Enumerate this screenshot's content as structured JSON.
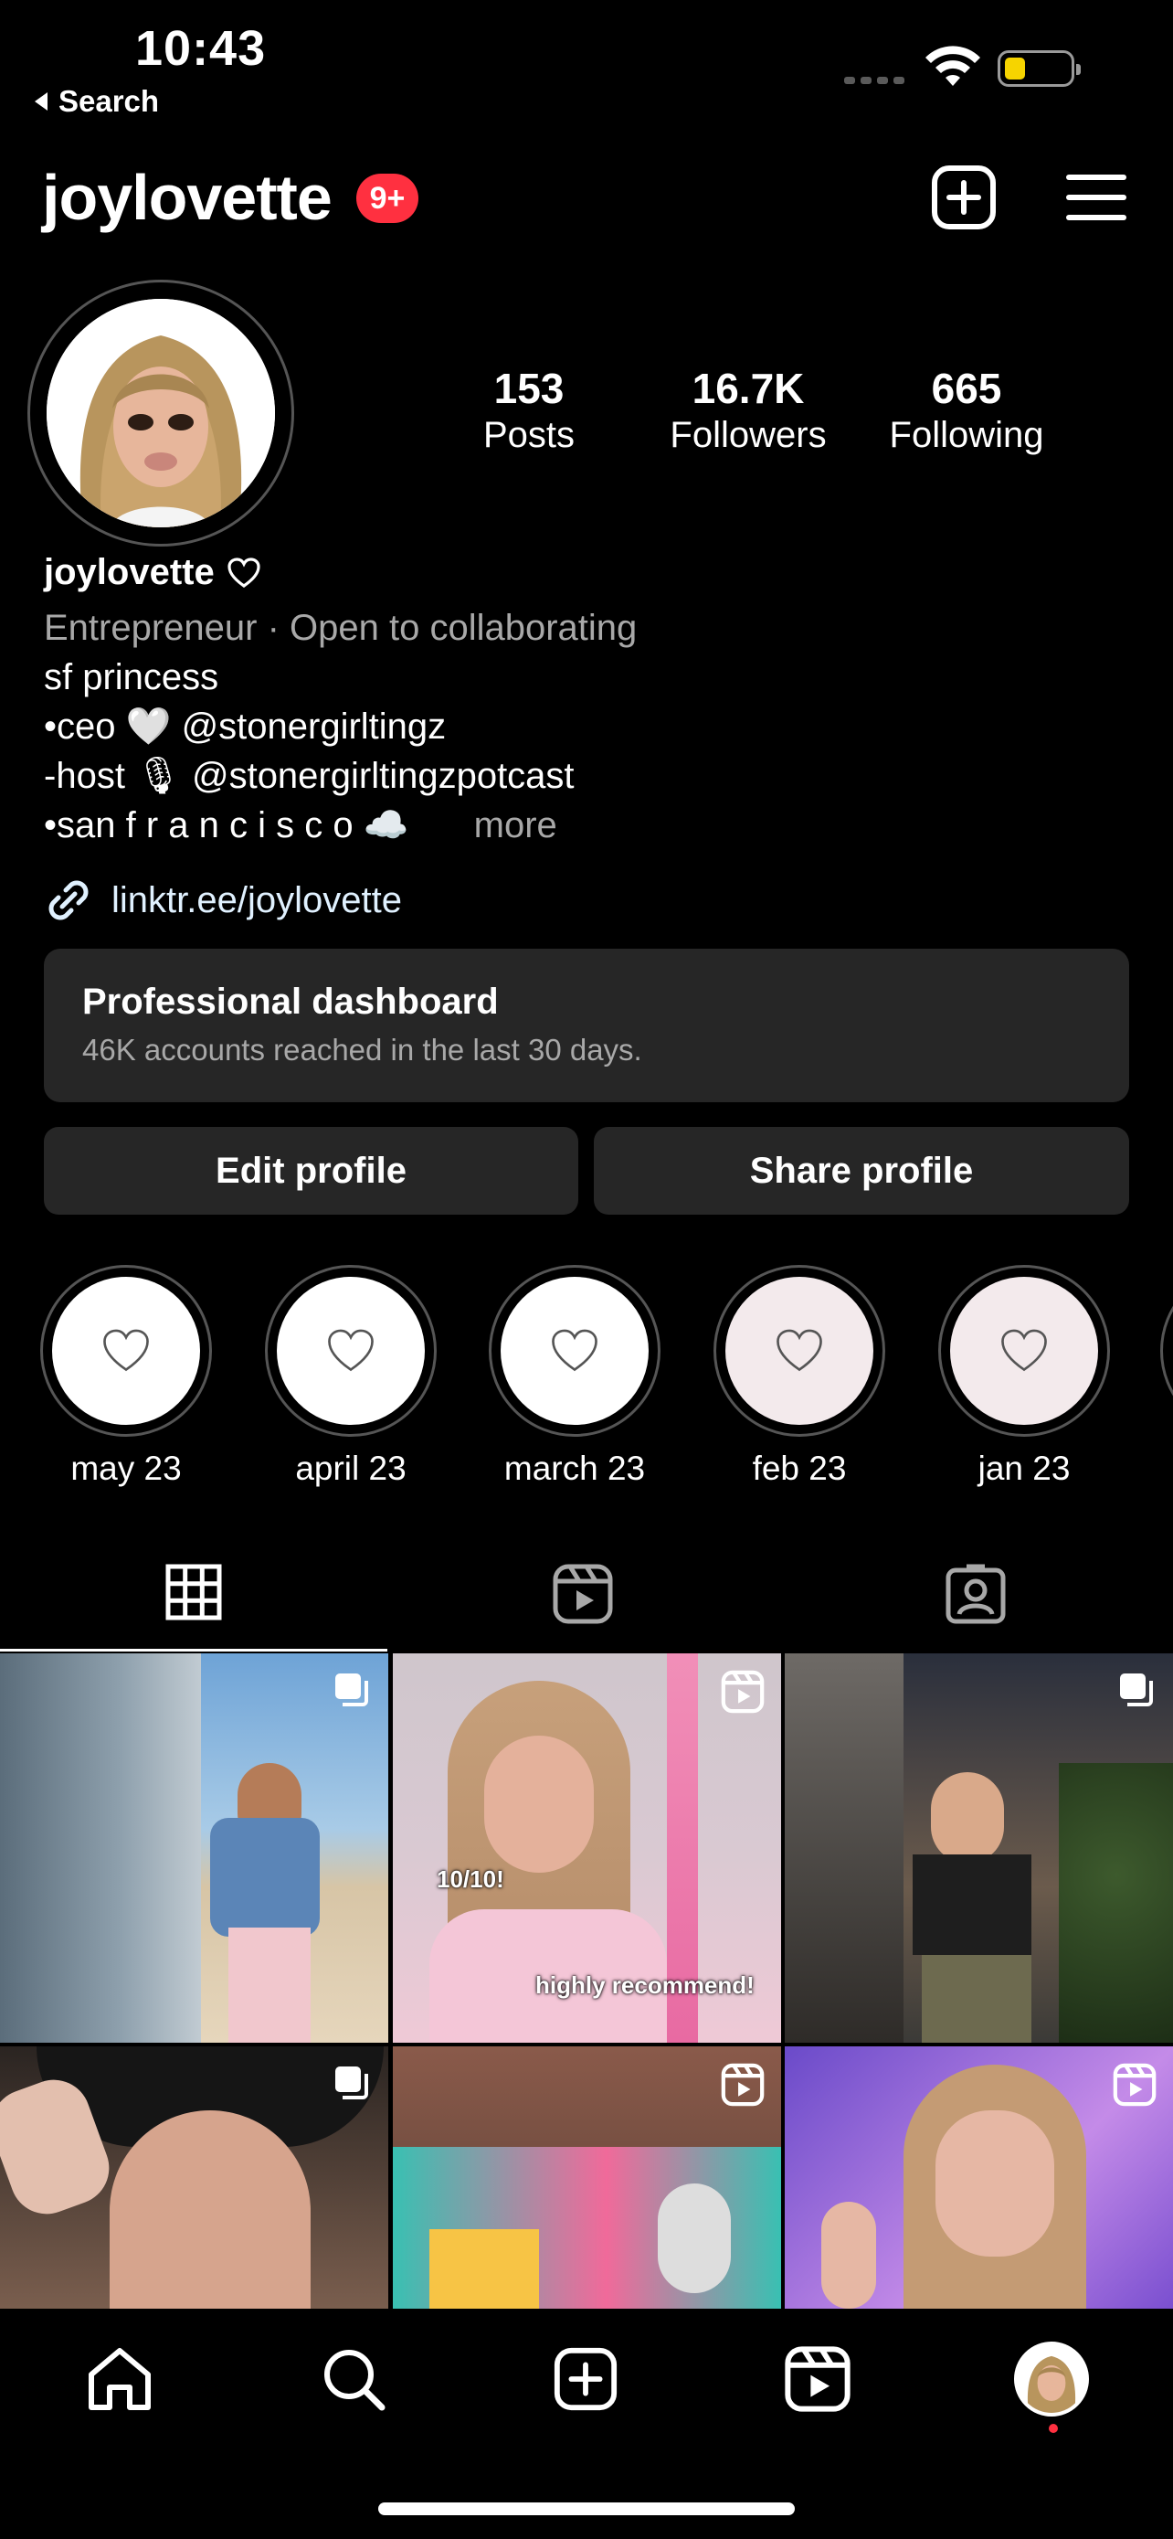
{
  "status_bar": {
    "time": "10:43",
    "back_label": "Search"
  },
  "header": {
    "username": "joylovette",
    "notification_badge": "9+",
    "icons": [
      "new-post-icon",
      "menu-icon"
    ]
  },
  "stats": [
    {
      "value": "153",
      "label": "Posts"
    },
    {
      "value": "16.7K",
      "label": "Followers"
    },
    {
      "value": "665",
      "label": "Following"
    }
  ],
  "bio": {
    "name": "joylovette",
    "category": "Entrepreneur · Open to collaborating",
    "line1": "sf princess",
    "line2_prefix": "•ceo",
    "line2_emoji": "🤍",
    "line2_handle": "@stonergirltingz",
    "line3_prefix": "-host",
    "line3_emoji": "🎙",
    "line3_handle": "@stonergirltingzpotcast",
    "line4": "•san f r a n c i s c o",
    "line4_emoji": "☁️",
    "more": "more",
    "link": "linktr.ee/joylovette"
  },
  "dashboard": {
    "title": "Professional dashboard",
    "subtitle": "46K accounts reached in the last 30 days."
  },
  "buttons": {
    "edit": "Edit profile",
    "share": "Share profile"
  },
  "highlights": [
    {
      "label": "may 23",
      "bg": "#ffffff"
    },
    {
      "label": "april 23",
      "bg": "#ffffff"
    },
    {
      "label": "march 23",
      "bg": "#ffffff"
    },
    {
      "label": "feb 23",
      "bg": "#f3eaec"
    },
    {
      "label": "jan 23",
      "bg": "#f3eaec"
    }
  ],
  "tabs": [
    "grid-icon",
    "reels-icon",
    "tagged-icon"
  ],
  "grid": [
    {
      "type": "carousel",
      "overlay": []
    },
    {
      "type": "reel",
      "overlay": [
        "10/10!",
        "highly recommend!"
      ]
    },
    {
      "type": "carousel",
      "overlay": []
    },
    {
      "type": "carousel",
      "overlay": []
    },
    {
      "type": "reel",
      "overlay": []
    },
    {
      "type": "reel",
      "overlay": []
    }
  ],
  "bottom_nav": [
    "home-icon",
    "search-icon",
    "create-icon",
    "reels-icon",
    "profile-avatar"
  ],
  "colors": {
    "accent_red": "#ff3040",
    "surface": "#262626",
    "muted_text": "#a8a8a8",
    "link_text": "#e0f1ff"
  }
}
